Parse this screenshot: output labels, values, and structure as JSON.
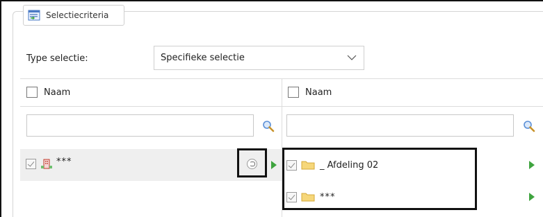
{
  "group": {
    "title": "Selectiecriteria",
    "icon": "list-window-icon"
  },
  "type_selection": {
    "label": "Type selectie:",
    "value": "Specifieke selectie",
    "icon": "chevron-down-icon"
  },
  "left_column": {
    "header_label": "Naam",
    "search_value": "",
    "rows": [
      {
        "name": "***",
        "icon": "organization-building-icon"
      }
    ]
  },
  "right_column": {
    "header_label": "Naam",
    "search_value": "",
    "rows": [
      {
        "name": "_ Afdeling 02",
        "icon": "folder-icon"
      },
      {
        "name": "***",
        "icon": "folder-icon"
      }
    ]
  },
  "colors": {
    "accent_green": "#3fa43f",
    "folder_yellow": "#f2c94c",
    "search_blue": "#5b8fd6"
  }
}
